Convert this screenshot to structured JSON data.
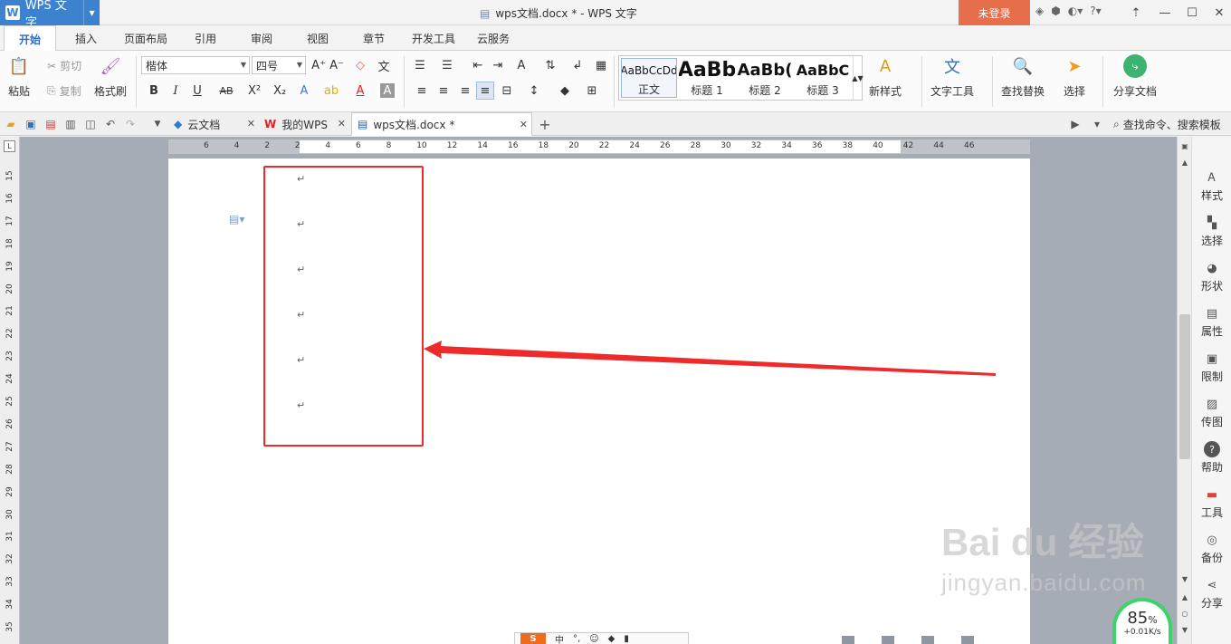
{
  "titlebar": {
    "app_name": "WPS 文字",
    "doc_title": "wps文档.docx * - WPS 文字",
    "login_label": "未登录",
    "icons": [
      "skin-icon",
      "lock-icon",
      "settings-icon",
      "help-icon"
    ],
    "help_label": "?"
  },
  "menu": {
    "tabs": [
      "开始",
      "插入",
      "页面布局",
      "引用",
      "审阅",
      "视图",
      "章节",
      "开发工具",
      "云服务"
    ],
    "active": "开始"
  },
  "ribbon": {
    "paste_label": "粘贴",
    "cut_label": "剪切",
    "copy_label": "复制",
    "format_painter_label": "格式刷",
    "font_name": "楷体",
    "font_size": "四号",
    "styles": [
      {
        "preview": "AaBbCcDd",
        "label": "正文"
      },
      {
        "preview": "AaBb",
        "label": "标题 1"
      },
      {
        "preview": "AaBb(",
        "label": "标题 2"
      },
      {
        "preview": "AaBbC",
        "label": "标题 3"
      }
    ],
    "new_style_label": "新样式",
    "text_tools_label": "文字工具",
    "find_replace_label": "查找替换",
    "select_label": "选择",
    "share_doc_label": "分享文档",
    "bold": "B",
    "italic": "I",
    "underline": "U",
    "strike": "AB",
    "superscript": "X²",
    "subscript": "X₂"
  },
  "tabbar": {
    "tabs": [
      {
        "label": "云文档"
      },
      {
        "label": "我的WPS"
      },
      {
        "label": "wps文档.docx *"
      }
    ],
    "search_label": "查找命令、搜索模板"
  },
  "ruler": {
    "h_ticks": [
      "6",
      "4",
      "2",
      "2",
      "4",
      "6",
      "8",
      "10",
      "12",
      "14",
      "16",
      "18",
      "20",
      "22",
      "24",
      "26",
      "28",
      "30",
      "32",
      "34",
      "36",
      "38",
      "40",
      "42",
      "44",
      "46"
    ],
    "v_ticks": [
      "15",
      "16",
      "17",
      "18",
      "19",
      "20",
      "21",
      "22",
      "23",
      "24",
      "25",
      "26",
      "27",
      "28",
      "29",
      "30",
      "31",
      "32",
      "33",
      "34",
      "35"
    ]
  },
  "document": {
    "paragraph_mark": "↵",
    "paragraph_count": 6
  },
  "sidebar": {
    "items": [
      {
        "label": "样式",
        "icon": "style-icon"
      },
      {
        "label": "选择",
        "icon": "select-icon"
      },
      {
        "label": "形状",
        "icon": "shape-icon"
      },
      {
        "label": "属性",
        "icon": "property-icon"
      },
      {
        "label": "限制",
        "icon": "restrict-icon"
      },
      {
        "label": "传图",
        "icon": "upload-image-icon"
      },
      {
        "label": "帮助",
        "icon": "help-icon"
      },
      {
        "label": "工具",
        "icon": "toolbox-icon"
      },
      {
        "label": "备份",
        "icon": "backup-icon"
      },
      {
        "label": "分享",
        "icon": "share-icon"
      }
    ]
  },
  "status": {
    "speed_percent": "85",
    "percent_sign": "%",
    "speed_rate": "+0.01K/s"
  },
  "watermark": {
    "brand": "Bai du 经验",
    "url": "jingyan.baidu.com"
  },
  "colors": {
    "accent": "#3c82cf",
    "login": "#e76e4a",
    "annotation": "#ee2a2a",
    "speed_ring": "#3dd36b"
  }
}
